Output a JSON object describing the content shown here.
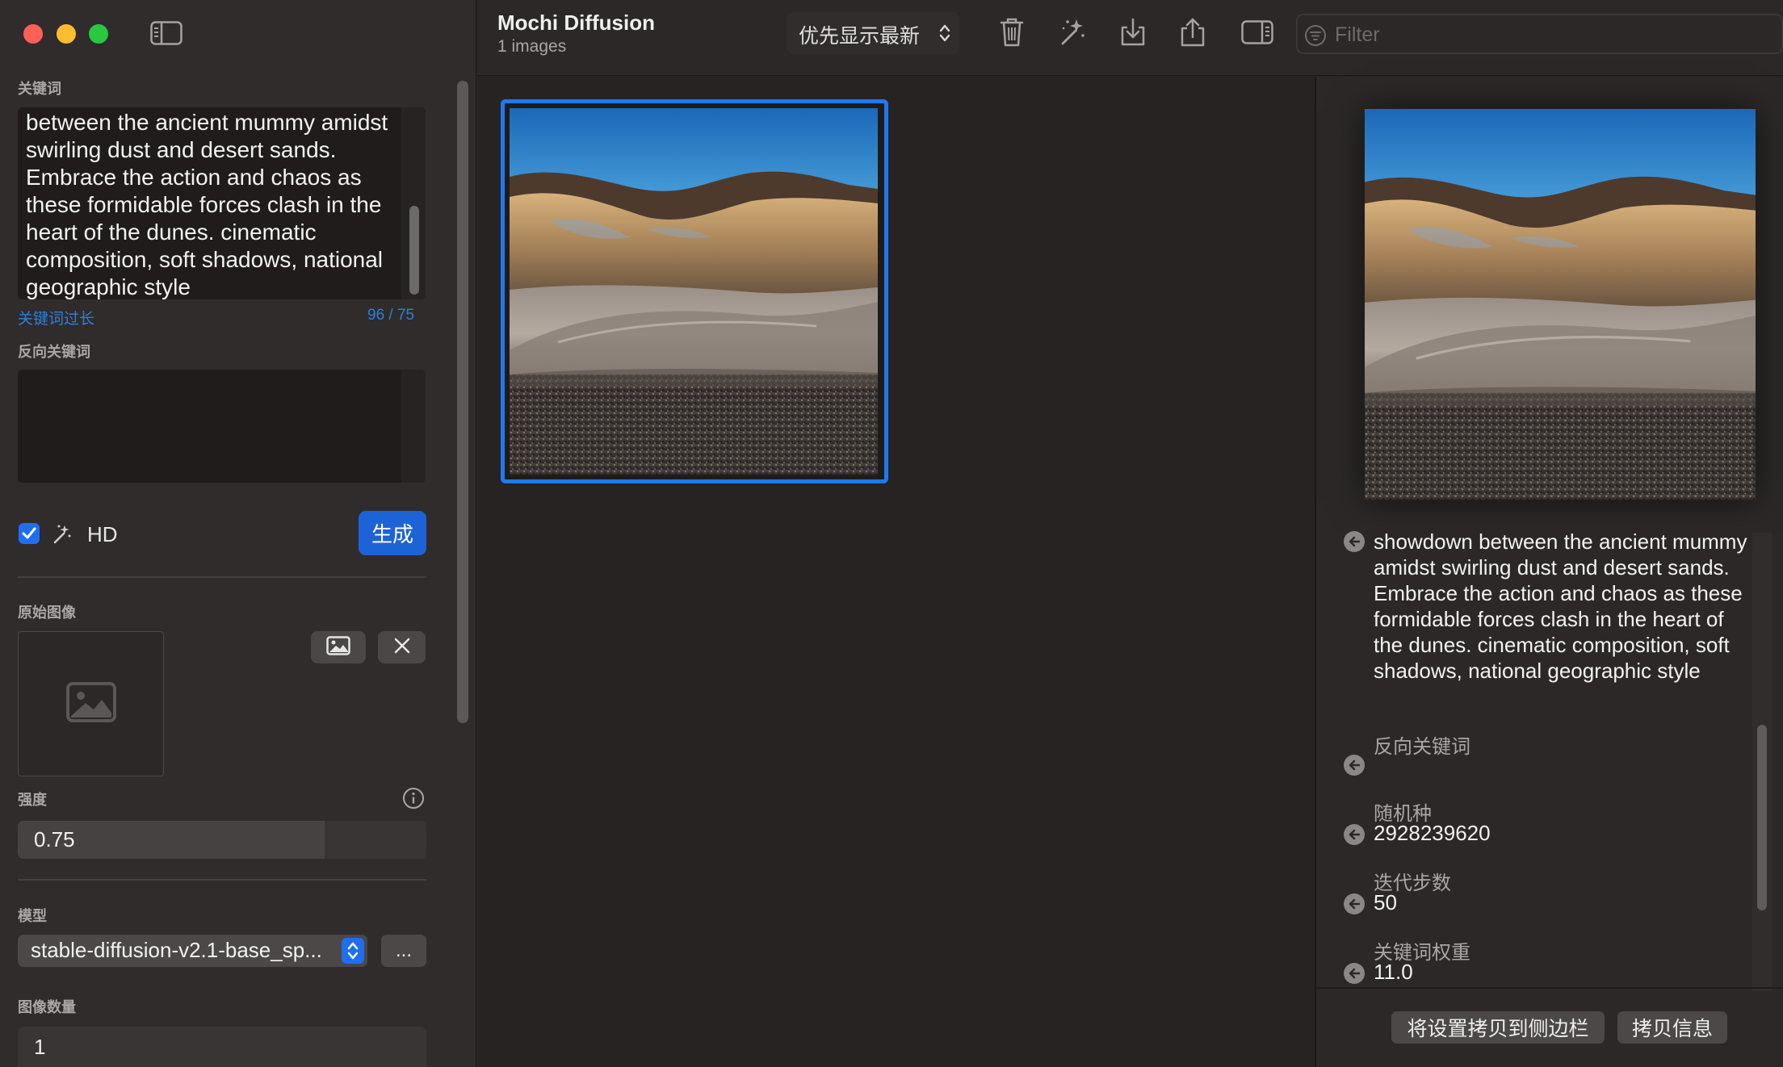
{
  "window": {
    "title": "Mochi Diffusion",
    "subtitle": "1 images"
  },
  "sidebar": {
    "prompt_label": "关键词",
    "prompt_text": "between the ancient mummy amidst swirling dust and desert sands. Embrace the action and chaos as these formidable forces clash in the heart of the dunes. cinematic composition, soft shadows, national geographic style",
    "prompt_warning": "关键词过长",
    "prompt_token_count": "96 / 75",
    "negative_prompt_label": "反向关键词",
    "negative_prompt_text": "",
    "hd_checked": true,
    "hd_label": "HD",
    "generate_label": "生成",
    "source_image_label": "原始图像",
    "strength_label": "强度",
    "strength_value": "0.75",
    "strength_level": 0.75,
    "model_label": "模型",
    "model_value": "stable-diffusion-v2.1-base_sp...",
    "more_label": "...",
    "image_count_label": "图像数量",
    "image_count_value": "1"
  },
  "toolbar": {
    "sort_label": "优先显示最新",
    "filter_placeholder": "Filter"
  },
  "inspector": {
    "prompt": "showdown between the ancient mummy amidst swirling dust and desert sands. Embrace the action and chaos as these formidable forces clash in the heart of the dunes. cinematic composition, soft shadows, national geographic style",
    "negative_prompt_label": "反向关键词",
    "negative_prompt_value": "",
    "seed_label": "随机种",
    "seed_value": "2928239620",
    "steps_label": "迭代步数",
    "steps_value": "50",
    "guidance_label": "关键词权重",
    "guidance_value": "11.0",
    "copy_settings_label": "将设置拷贝到侧边栏",
    "copy_info_label": "拷贝信息"
  },
  "colors": {
    "accent": "#1f79f2",
    "button_blue": "#1d63d8",
    "warning_blue": "#2f7fd9"
  },
  "icons": [
    "sidebar-toggle-icon",
    "magic-wand-icon",
    "trash-icon",
    "wand-sparkle-icon",
    "download-icon",
    "share-icon",
    "inspector-toggle-icon",
    "filter-icon",
    "image-icon",
    "close-icon",
    "info-icon",
    "arrow-left-icon",
    "chevron-updown-icon"
  ]
}
